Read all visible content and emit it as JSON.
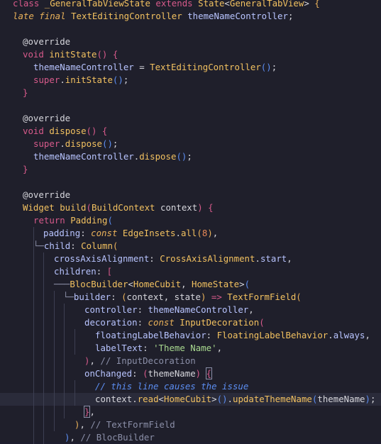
{
  "editor": {
    "language": "dart",
    "lines": [
      [
        [
          "k",
          "class "
        ],
        [
          "t",
          "_GeneralTabViewState "
        ],
        [
          "k",
          "extends "
        ],
        [
          "t",
          "State"
        ],
        [
          "a",
          "<"
        ],
        [
          "t",
          "GeneralTabView"
        ],
        [
          "a",
          "> "
        ],
        [
          "p1",
          "{"
        ]
      ],
      [
        [
          "i",
          "late final "
        ],
        [
          "t",
          "TextEditingController "
        ],
        [
          "v",
          "themeNameController"
        ],
        [
          "a",
          ";"
        ]
      ],
      [],
      [
        [
          "an",
          "@override"
        ]
      ],
      [
        [
          "k",
          "void "
        ],
        [
          "f",
          "initState"
        ],
        [
          "p2",
          "()"
        ],
        [
          "a",
          " "
        ],
        [
          "p2",
          "{"
        ]
      ],
      [
        [
          "v",
          "themeNameController"
        ],
        [
          "a",
          " = "
        ],
        [
          "f",
          "TextEditingController"
        ],
        [
          "p3",
          "()"
        ],
        [
          "a",
          ";"
        ]
      ],
      [
        [
          "k",
          "super"
        ],
        [
          "a",
          "."
        ],
        [
          "f",
          "initState"
        ],
        [
          "p3",
          "()"
        ],
        [
          "a",
          ";"
        ]
      ],
      [
        [
          "p2",
          "}"
        ]
      ],
      [],
      [
        [
          "an",
          "@override"
        ]
      ],
      [
        [
          "k",
          "void "
        ],
        [
          "f",
          "dispose"
        ],
        [
          "p2",
          "()"
        ],
        [
          "a",
          " "
        ],
        [
          "p2",
          "{"
        ]
      ],
      [
        [
          "k",
          "super"
        ],
        [
          "a",
          "."
        ],
        [
          "f",
          "dispose"
        ],
        [
          "p3",
          "()"
        ],
        [
          "a",
          ";"
        ]
      ],
      [
        [
          "v",
          "themeNameController"
        ],
        [
          "a",
          "."
        ],
        [
          "f",
          "dispose"
        ],
        [
          "p3",
          "()"
        ],
        [
          "a",
          ";"
        ]
      ],
      [
        [
          "p2",
          "}"
        ]
      ],
      [],
      [
        [
          "an",
          "@override"
        ]
      ],
      [
        [
          "t",
          "Widget "
        ],
        [
          "f",
          "build"
        ],
        [
          "p2",
          "("
        ],
        [
          "t",
          "BuildContext "
        ],
        [
          "a",
          "context"
        ],
        [
          "p2",
          ")"
        ],
        [
          "a",
          " "
        ],
        [
          "p2",
          "{"
        ]
      ],
      [
        [
          "k",
          "return "
        ],
        [
          "f",
          "Padding"
        ],
        [
          "p3",
          "("
        ]
      ],
      [
        [
          "v",
          "padding"
        ],
        [
          "a",
          ": "
        ],
        [
          "i",
          "const "
        ],
        [
          "t",
          "EdgeInsets"
        ],
        [
          "a",
          "."
        ],
        [
          "f",
          "all"
        ],
        [
          "p1",
          "("
        ],
        [
          "n",
          "8"
        ],
        [
          "p1",
          ")"
        ],
        [
          "a",
          ","
        ]
      ],
      [
        [
          "tree",
          "└─"
        ],
        [
          "v",
          "child"
        ],
        [
          "a",
          ": "
        ],
        [
          "f",
          "Column"
        ],
        [
          "p1",
          "("
        ]
      ],
      [
        [
          "v",
          "crossAxisAlignment"
        ],
        [
          "a",
          ": "
        ],
        [
          "t",
          "CrossAxisAlignment"
        ],
        [
          "a",
          "."
        ],
        [
          "v",
          "start"
        ],
        [
          "a",
          ","
        ]
      ],
      [
        [
          "v",
          "children"
        ],
        [
          "a",
          ": "
        ],
        [
          "p2",
          "["
        ]
      ],
      [
        [
          "tree",
          "───"
        ],
        [
          "f",
          "BlocBuilder"
        ],
        [
          "a",
          "<"
        ],
        [
          "t",
          "HomeCubit"
        ],
        [
          "a",
          ", "
        ],
        [
          "t",
          "HomeState"
        ],
        [
          "a",
          ">"
        ],
        [
          "p3",
          "("
        ]
      ],
      [
        [
          "tree",
          "└─"
        ],
        [
          "v",
          "builder"
        ],
        [
          "a",
          ": "
        ],
        [
          "p1",
          "("
        ],
        [
          "a",
          "context, state"
        ],
        [
          "p1",
          ")"
        ],
        [
          "a",
          " "
        ],
        [
          "k",
          "=>"
        ],
        [
          "a",
          " "
        ],
        [
          "f",
          "TextFormField"
        ],
        [
          "p1",
          "("
        ]
      ],
      [
        [
          "v",
          "controller"
        ],
        [
          "a",
          ": "
        ],
        [
          "v",
          "themeNameController"
        ],
        [
          "a",
          ","
        ]
      ],
      [
        [
          "v",
          "decoration"
        ],
        [
          "a",
          ": "
        ],
        [
          "i",
          "const "
        ],
        [
          "t",
          "InputDecoration"
        ],
        [
          "p2",
          "("
        ]
      ],
      [
        [
          "v",
          "floatingLabelBehavior"
        ],
        [
          "a",
          ": "
        ],
        [
          "t",
          "FloatingLabelBehavior"
        ],
        [
          "a",
          "."
        ],
        [
          "v",
          "always"
        ],
        [
          "a",
          ","
        ]
      ],
      [
        [
          "v",
          "labelText"
        ],
        [
          "a",
          ": "
        ],
        [
          "s",
          "'Theme Name'"
        ],
        [
          "a",
          ","
        ]
      ],
      [
        [
          "p2",
          ")"
        ],
        [
          "a",
          ", "
        ],
        [
          "c",
          "// InputDecoration"
        ]
      ],
      [
        [
          "v",
          "onChanged"
        ],
        [
          "a",
          ": "
        ],
        [
          "p2",
          "("
        ],
        [
          "a",
          "themeName"
        ],
        [
          "p2",
          ")"
        ],
        [
          "a",
          " "
        ],
        [
          "p2",
          "{"
        ]
      ],
      [
        [
          "cb",
          "// this line causes the issue"
        ]
      ],
      [
        [
          "a",
          "context"
        ],
        [
          "a",
          "."
        ],
        [
          "f",
          "read"
        ],
        [
          "a",
          "<"
        ],
        [
          "t",
          "HomeCubit"
        ],
        [
          "a",
          ">"
        ],
        [
          "p3",
          "()"
        ],
        [
          "a",
          "."
        ],
        [
          "f",
          "updateThemeName"
        ],
        [
          "p3",
          "("
        ],
        [
          "a",
          "themeName"
        ],
        [
          "p3",
          ")"
        ],
        [
          "a",
          ";"
        ]
      ],
      [
        [
          "p2",
          "}"
        ],
        [
          "a",
          ","
        ]
      ],
      [
        [
          "p1",
          ")"
        ],
        [
          "a",
          ", "
        ],
        [
          "c",
          "// TextFormField"
        ]
      ],
      [
        [
          "p3",
          ")"
        ],
        [
          "a",
          ", "
        ],
        [
          "c",
          "// BlocBuilder"
        ]
      ]
    ],
    "highlight_line": 31,
    "lightbulb_icon": "lightbulb-icon"
  }
}
